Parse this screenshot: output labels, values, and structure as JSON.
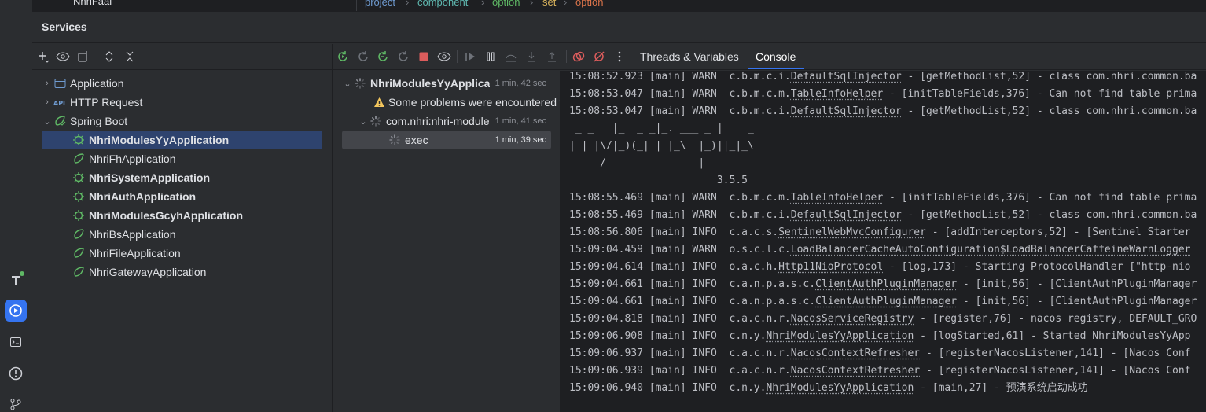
{
  "top_strip": {
    "left_item": "NhriFaai",
    "breadcrumb": [
      "project",
      "component",
      "option",
      "set",
      "option"
    ]
  },
  "services": {
    "title": "Services"
  },
  "tree": {
    "items": [
      {
        "label": "Application",
        "icon": "application-icon",
        "expanded": false
      },
      {
        "label": "HTTP Request",
        "icon": "api-icon",
        "expanded": false
      },
      {
        "label": "Spring Boot",
        "icon": "spring-boot-icon",
        "expanded": true
      },
      {
        "label": "NhriModulesYyApplication",
        "running": true
      },
      {
        "label": "NhriFhApplication",
        "running": false
      },
      {
        "label": "NhriSystemApplication",
        "running": true
      },
      {
        "label": "NhriAuthApplication",
        "running": true
      },
      {
        "label": "NhriModulesGcyhApplication",
        "running": true
      },
      {
        "label": "NhriBsApplication",
        "running": false
      },
      {
        "label": "NhriFileApplication",
        "running": false
      },
      {
        "label": "NhriGatewayApplication",
        "running": false
      }
    ]
  },
  "run_tree": {
    "root": {
      "label": "NhriModulesYyApplica",
      "duration": "1 min, 42 sec"
    },
    "warning": {
      "label": "Some problems were encountered w"
    },
    "module": {
      "label": "com.nhri:nhri-module",
      "duration": "1 min, 41 sec"
    },
    "exec": {
      "label": "exec",
      "duration": "1 min, 39 sec"
    }
  },
  "tabs": {
    "threads": "Threads & Variables",
    "console": "Console"
  },
  "console": {
    "lines": [
      {
        "pre": "15:08:52.923 [main] WARN  c.b.m.c.i.",
        "cls": "DefaultSqlInjector",
        "post": " - [getMethodList,52] - class com.nhri.common.ba"
      },
      {
        "pre": "15:08:53.047 [main] WARN  c.b.m.c.m.",
        "cls": "TableInfoHelper",
        "post": " - [initTableFields,376] - Can not find table prima"
      },
      {
        "pre": "15:08:53.047 [main] WARN  c.b.m.c.i.",
        "cls": "DefaultSqlInjector",
        "post": " - [getMethodList,52] - class com.nhri.common.ba"
      },
      {
        "pre": " _ _   |_  _ _|_. ___ _ |    _ ",
        "cls": "",
        "post": ""
      },
      {
        "pre": "| | |\\/|_)(_| | |_\\  |_)||_|_\\ ",
        "cls": "",
        "post": ""
      },
      {
        "pre": "     /               |         ",
        "cls": "",
        "post": ""
      },
      {
        "pre": "                        3.5.5 ",
        "cls": "",
        "post": ""
      },
      {
        "pre": "15:08:55.469 [main] WARN  c.b.m.c.m.",
        "cls": "TableInfoHelper",
        "post": " - [initTableFields,376] - Can not find table prima"
      },
      {
        "pre": "15:08:55.469 [main] WARN  c.b.m.c.i.",
        "cls": "DefaultSqlInjector",
        "post": " - [getMethodList,52] - class com.nhri.common.ba"
      },
      {
        "pre": "15:08:56.806 [main] INFO  c.a.c.s.",
        "cls": "SentinelWebMvcConfigurer",
        "post": " - [addInterceptors,52] - [Sentinel Starter"
      },
      {
        "pre": "15:09:04.459 [main] WARN  o.s.c.l.c.",
        "cls": "LoadBalancerCacheAutoConfiguration$LoadBalancerCaffeineWarnLogger",
        "post": ""
      },
      {
        "pre": "15:09:04.614 [main] INFO  o.a.c.h.",
        "cls": "Http11NioProtocol",
        "post": " - [log,173] - Starting ProtocolHandler [\"http-nio"
      },
      {
        "pre": "15:09:04.661 [main] INFO  c.a.n.p.a.s.c.",
        "cls": "ClientAuthPluginManager",
        "post": " - [init,56] - [ClientAuthPluginManager"
      },
      {
        "pre": "15:09:04.661 [main] INFO  c.a.n.p.a.s.c.",
        "cls": "ClientAuthPluginManager",
        "post": " - [init,56] - [ClientAuthPluginManager"
      },
      {
        "pre": "15:09:04.818 [main] INFO  c.a.c.n.r.",
        "cls": "NacosServiceRegistry",
        "post": " - [register,76] - nacos registry, DEFAULT_GRO"
      },
      {
        "pre": "15:09:06.908 [main] INFO  c.n.y.",
        "cls": "NhriModulesYyApplication",
        "post": " - [logStarted,61] - Started NhriModulesYyApp"
      },
      {
        "pre": "15:09:06.937 [main] INFO  c.a.c.n.r.",
        "cls": "NacosContextRefresher",
        "post": " - [registerNacosListener,141] - [Nacos Conf"
      },
      {
        "pre": "15:09:06.939 [main] INFO  c.a.c.n.r.",
        "cls": "NacosContextRefresher",
        "post": " - [registerNacosListener,141] - [Nacos Conf"
      },
      {
        "pre": "15:09:06.940 [main] INFO  c.n.y.",
        "cls": "NhriModulesYyApplication",
        "post": " - [main,27] - 预演系统启动成功"
      }
    ]
  },
  "colors": {
    "accent": "#3574f0",
    "spring_green": "#5fb865",
    "warning": "#f2c55c",
    "stop_red": "#db5c5c"
  }
}
